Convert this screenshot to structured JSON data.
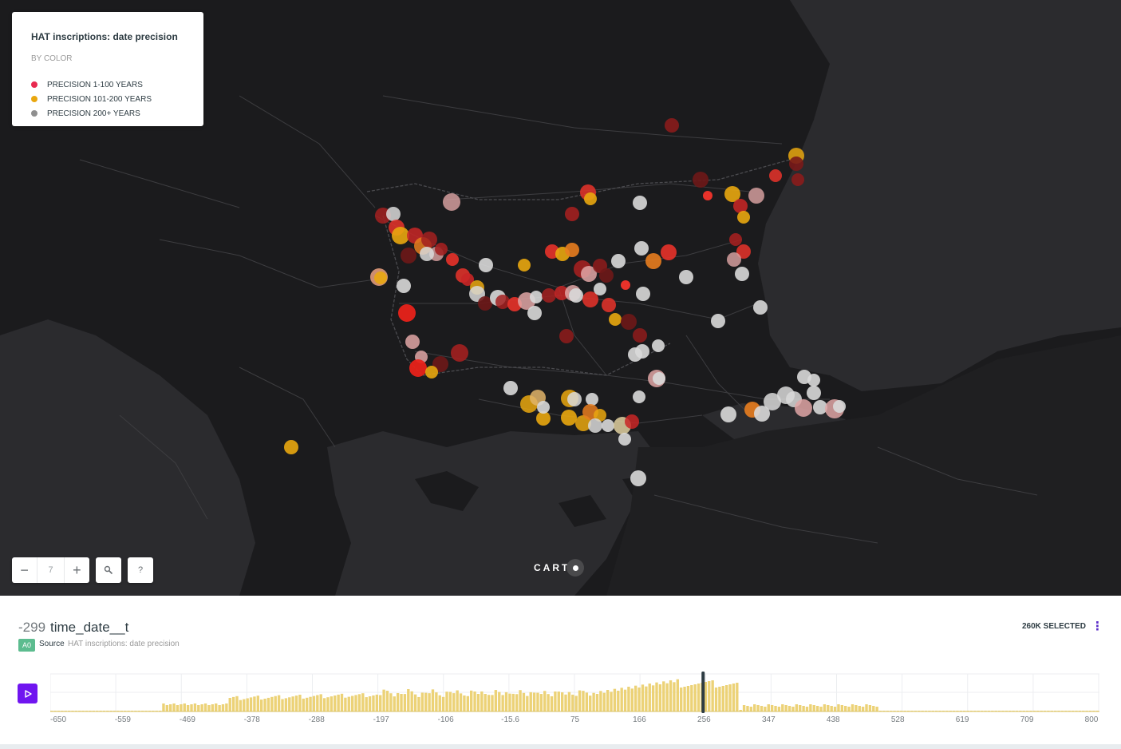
{
  "legend": {
    "title": "HAT inscriptions: date precision",
    "by_label": "BY COLOR",
    "items": [
      {
        "label": "PRECISION 1-100 YEARS",
        "color": "#e8294f"
      },
      {
        "label": "PRECISION 101-200 YEARS",
        "color": "#e9a70f"
      },
      {
        "label": "PRECISION 200+ YEARS",
        "color": "#8f8f8f"
      }
    ]
  },
  "map_controls": {
    "zoom_out": "−",
    "zoom_level": "7",
    "zoom_in": "+",
    "search": "🔍",
    "help": "?"
  },
  "attribution": {
    "brand": "CART"
  },
  "timeseries": {
    "current_value": "-299",
    "field": "time_date__t",
    "selected": "260K SELECTED",
    "menu": "⋮",
    "source_tag": "A0",
    "source_label": "Source",
    "source_name": "HAT inscriptions: date precision",
    "axis_ticks": [
      "-650",
      "-559",
      "-469",
      "-378",
      "-288",
      "-197",
      "-106",
      "-15.6",
      "75",
      "166",
      "256",
      "347",
      "438",
      "528",
      "619",
      "709",
      "800"
    ],
    "colors": {
      "bar": "#ecd277",
      "accent": "#7015f0",
      "cursor": "#2e3c43"
    }
  }
}
